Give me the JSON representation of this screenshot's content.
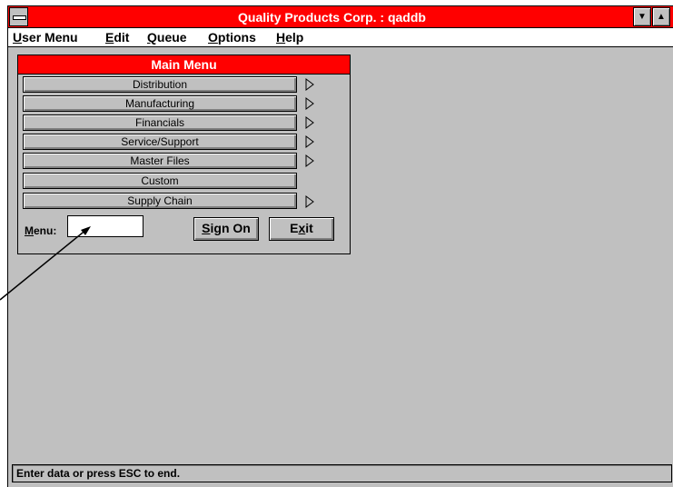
{
  "window": {
    "title": "Quality Products Corp. : qaddb",
    "minimize_glyph": "▼",
    "maximize_glyph": "▲"
  },
  "menubar": {
    "items": [
      {
        "label": "User Menu",
        "mnemonic": "U"
      },
      {
        "label": "Edit",
        "mnemonic": "E"
      },
      {
        "label": "Queue",
        "mnemonic": "Q"
      },
      {
        "label": "Options",
        "mnemonic": "O"
      },
      {
        "label": "Help",
        "mnemonic": "H"
      }
    ]
  },
  "main_menu": {
    "title": "Main Menu",
    "items": [
      {
        "label": "Distribution",
        "has_submenu": true
      },
      {
        "label": "Manufacturing",
        "has_submenu": true
      },
      {
        "label": "Financials",
        "has_submenu": true
      },
      {
        "label": "Service/Support",
        "has_submenu": true
      },
      {
        "label": "Master Files",
        "has_submenu": true
      },
      {
        "label": "Custom",
        "has_submenu": false
      },
      {
        "label": "Supply Chain",
        "has_submenu": true
      }
    ],
    "menu_field": {
      "label": "Menu:",
      "value": ""
    },
    "sign_on_label": "Sign On",
    "exit_label": "Exit"
  },
  "status": {
    "text": "Enter data or press ESC to end."
  },
  "colors": {
    "titlebar": "#ff0000",
    "workspace": "#c0c0c0"
  }
}
